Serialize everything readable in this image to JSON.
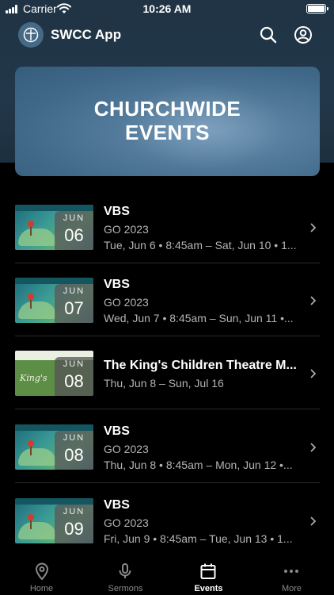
{
  "status_bar": {
    "carrier": "Carrier",
    "time": "10:26 AM"
  },
  "app_bar": {
    "title": "SWCC App",
    "logo_icon": "cross-circle-icon",
    "search_icon": "search-icon",
    "account_icon": "account-circle-icon"
  },
  "hero": {
    "title_line1": "CHURCHWIDE",
    "title_line2": "EVENTS"
  },
  "events": [
    {
      "title": "VBS",
      "subtitle": "GO 2023",
      "dates": "Tue, Jun 6 • 8:45am – Sat, Jun 10 • 1...",
      "month": "JUN",
      "day": "06",
      "thumb": "vbs"
    },
    {
      "title": "VBS",
      "subtitle": "GO 2023",
      "dates": "Wed, Jun 7 • 8:45am – Sun, Jun 11 •...",
      "month": "JUN",
      "day": "07",
      "thumb": "vbs"
    },
    {
      "title": "The King's Children Theatre M...",
      "subtitle": "",
      "dates": "Thu, Jun 8 – Sun, Jul 16",
      "month": "JUN",
      "day": "08",
      "thumb": "kings",
      "thumb_text": "King's"
    },
    {
      "title": "VBS",
      "subtitle": "GO 2023",
      "dates": "Thu, Jun 8 • 8:45am – Mon, Jun 12 •...",
      "month": "JUN",
      "day": "08",
      "thumb": "vbs"
    },
    {
      "title": "VBS",
      "subtitle": "GO 2023",
      "dates": "Fri, Jun 9 • 8:45am – Tue, Jun 13 • 1...",
      "month": "JUN",
      "day": "09",
      "thumb": "vbs"
    }
  ],
  "tabs": [
    {
      "label": "Home",
      "icon": "location-pin-icon",
      "active": false
    },
    {
      "label": "Sermons",
      "icon": "microphone-icon",
      "active": false
    },
    {
      "label": "Events",
      "icon": "calendar-icon",
      "active": true
    },
    {
      "label": "More",
      "icon": "more-dots-icon",
      "active": false
    }
  ],
  "colors": {
    "header_bg": "#22384a",
    "hero_bg": "#4f7696",
    "background": "#000000",
    "secondary_text": "#b4b4b4",
    "inactive_tab": "#8a8a8a"
  }
}
